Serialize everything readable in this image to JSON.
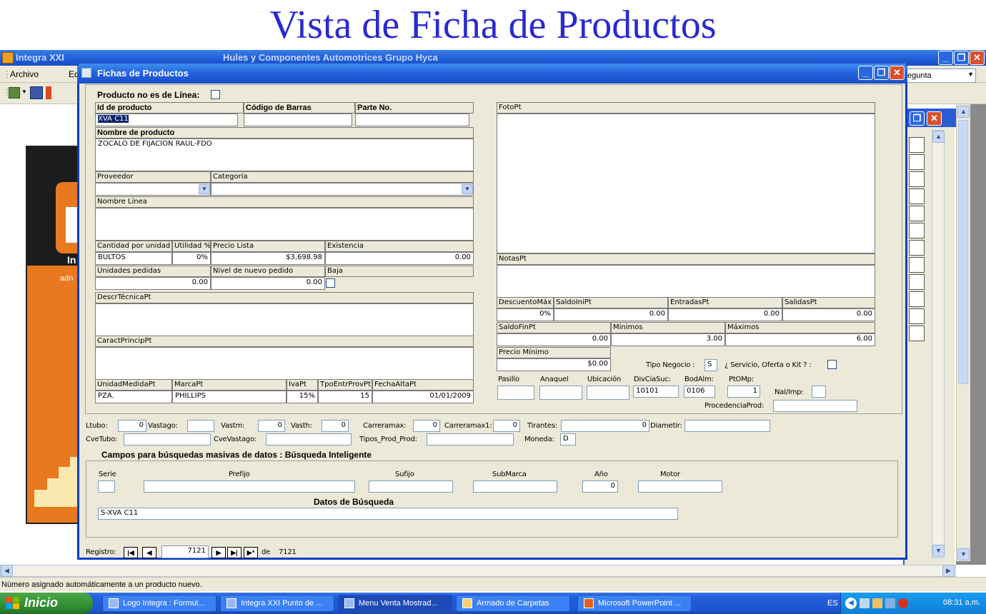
{
  "slide_title": "Vista de Ficha de Productos",
  "app": {
    "title": "Integra XXI",
    "company": "Hules y Componentes Automotrices Grupo Hyca",
    "menu": [
      "Archivo",
      "Ed"
    ],
    "question_box": "egunta",
    "status_text": "Número asignado automáticamente a un producto nuevo.",
    "logo_text": "In",
    "logo_subtext": "adn"
  },
  "dialog": {
    "title": "Fichas de Productos",
    "no_line_label": "Producto no es de Línea:",
    "headers": {
      "id": "Id de producto",
      "barcode": "Código de Barras",
      "part": "Parte No.",
      "name": "Nombre de producto",
      "provider": "Proveedor",
      "category": "Categoría",
      "line_name": "Nombre Línea",
      "qty_unit": "Cantidad por unidad",
      "utility": "Utilidad %",
      "list_price": "Precio Lista",
      "stock": "Existencia",
      "units_ordered": "Unidades pedidas",
      "reorder": "Nivel de nuevo pedido",
      "drop": "Baja",
      "tech_desc": "DescrTécnicaPt",
      "main_feat": "CaractPrincipPt",
      "unit_measure": "UnidadMedidaPt",
      "brand": "MarcaPt",
      "iva": "IvaPt",
      "delivery": "TpoEntrProvPt",
      "date_high": "FechaAltaPt",
      "photo": "FotoPt",
      "notes": "NotasPt",
      "max_disc": "DescuentoMáx",
      "init_bal": "SaldoIniPt",
      "entries": "EntradasPt",
      "exits": "SalidasPt",
      "final_bal": "SaldoFinPt",
      "minimums": "Mínimos",
      "maximums": "Máximos",
      "min_price": "Precio Mínimo",
      "biz_type": "Tipo Negocio :",
      "service_q": "¿ Servicio, Oferta o Kit ? :",
      "aisle": "Pasillo",
      "shelf": "Anaquel",
      "location": "Ubicación",
      "divcia": "DivCiaSuc:",
      "bodalm": "BodAlm:",
      "ptomp": "PtOMp:",
      "nalimp": "Nal/Imp:",
      "procedence": "ProcedenciaProd:"
    },
    "values": {
      "id": "XVA C11",
      "name": "ZOCALO DE FIJACION RAUL-FDO",
      "qty_unit": "BULTOS",
      "utility": "0%",
      "list_price": "$3,698.98",
      "stock": "0.00",
      "units_ordered": "0.00",
      "reorder": "0.00",
      "unit_measure": "PZA.",
      "brand": "PHILLIPS",
      "iva": "15%",
      "delivery": "15",
      "date_high": "01/01/2009",
      "max_disc": "0%",
      "init_bal": "0.00",
      "entries": "0.00",
      "exits": "0.00",
      "final_bal": "0.00",
      "minimums": "3.00",
      "maximums": "6.00",
      "min_price": "$0.00",
      "biz_type": "S",
      "divcia": "10101",
      "bodalm": "0106",
      "ptomp": "1"
    },
    "row1": {
      "ltubo_label": "Ltubo:",
      "ltubo": "0",
      "vastago_label": "Vastago:",
      "vastm_label": "Vastm:",
      "vastm": "0",
      "vasth_label": "Vasth:",
      "vasth": "0",
      "carreramax_label": "Carreramax:",
      "carreramax": "0",
      "carreramax1_label": "Carreramax1:",
      "carreramax1": "0",
      "tirantes_label": "Tirantes:",
      "tirantes": "0",
      "diametir_label": "Diametir:"
    },
    "row2": {
      "cvetubo_label": "CveTubo:",
      "cvevastago_label": "CveVastago:",
      "tipos_label": "Tipos_Prod_Prod:",
      "moneda_label": "Moneda:",
      "moneda": "D"
    },
    "search": {
      "title": "Campos para búsquedas masivas de datos : Búsqueda Inteligente",
      "serie": "Serie",
      "prefijo": "Prefijo",
      "sufijo": "Sufijo",
      "submarca": "SubMarca",
      "anio": "Año",
      "anio_value": "0",
      "motor": "Motor",
      "datos_label": "Datos de Búsqueda",
      "datos_value": "S-XVA C11"
    },
    "nav": {
      "label": "Registro:",
      "current": "7121",
      "of_label": "de",
      "total": "7121"
    }
  },
  "taskbar": {
    "start": "Inicio",
    "tasks": [
      "Logo Integra : Formul...",
      "Integra XXI Punto de ...",
      "Menu Venta Mostrad...",
      "Armado de Carpetas",
      "Microsoft PowerPoint ..."
    ],
    "lang": "ES",
    "clock": "08:31 a.m."
  },
  "colors": {
    "title_blue": "#2a2ad0",
    "xp_blue": "#2160dd",
    "dialog_face": "#ece9d8",
    "accent_orange": "#e8791f"
  }
}
